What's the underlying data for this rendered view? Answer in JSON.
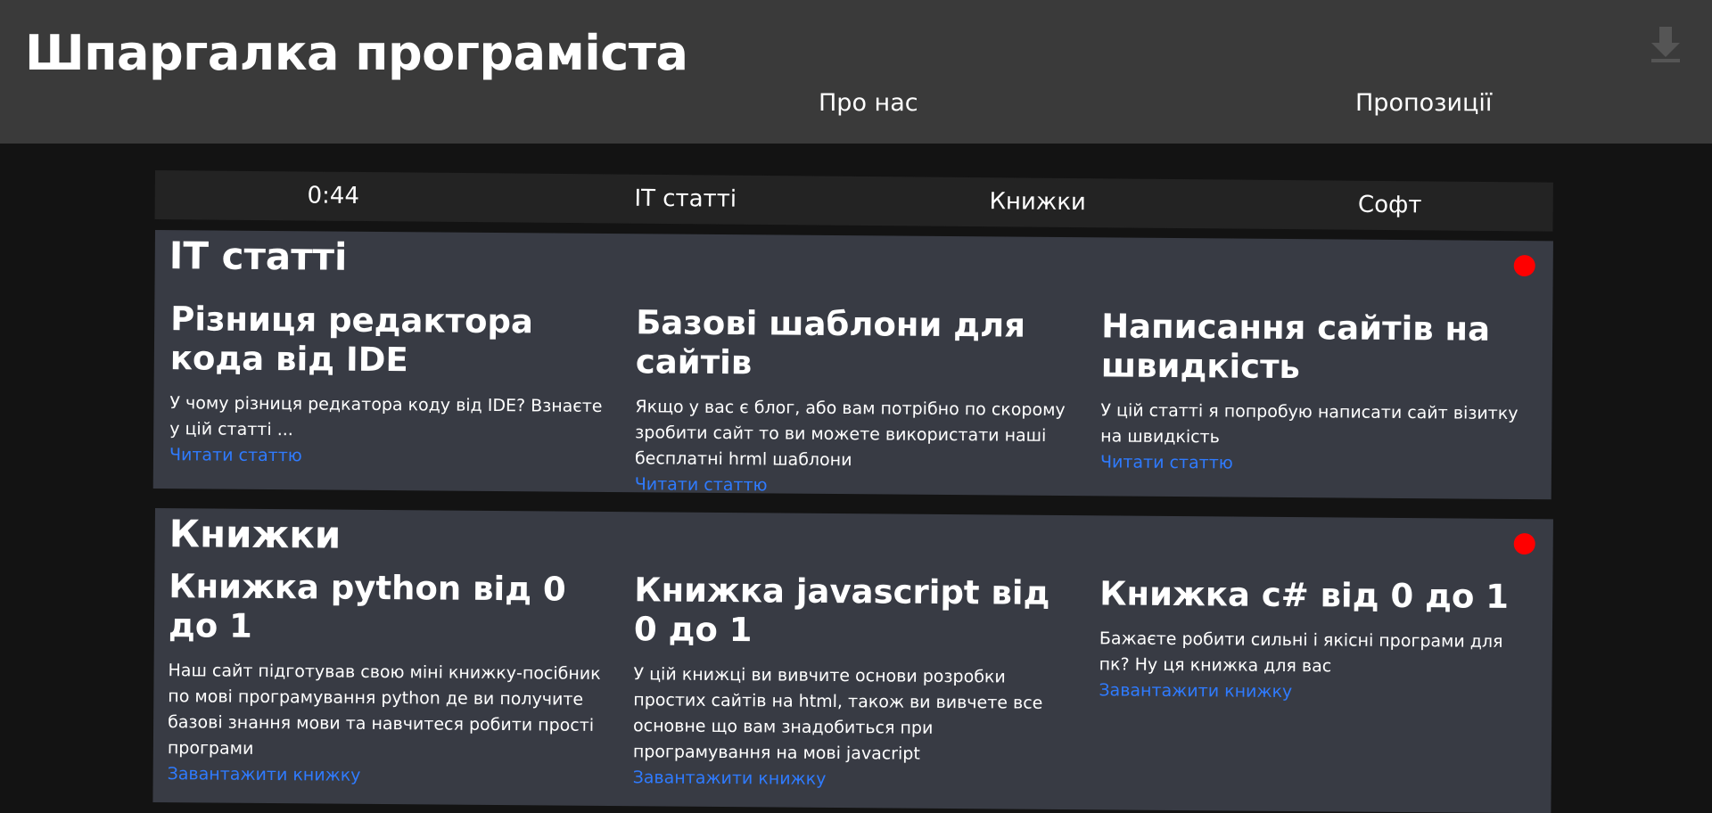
{
  "header": {
    "title": "Шпаргалка програміста",
    "links": [
      "Про нас",
      "Пропозиції"
    ],
    "download_icon": "download-arrow-icon"
  },
  "nav": {
    "items": [
      "0:44",
      "IT статті",
      "Книжки",
      "Софт"
    ]
  },
  "sections": [
    {
      "title": "IT статті",
      "cards": [
        {
          "title": "Різниця редактора кода від IDE",
          "text": "У чому різниця редкатора коду від IDE? Взнаєте у цій статті ...",
          "link": "Читати статтю"
        },
        {
          "title": "Базові шаблони для сайтів",
          "text": "Якщо у вас є блог, або вам потрібно по скорому зробити сайт то ви можете використати наші бесплатні hrml шаблони",
          "link": "Читати статтю"
        },
        {
          "title": "Написання сайтів на швидкість",
          "text": "У цій статті я попробую написати сайт візитку на швидкість",
          "link": "Читати статтю"
        }
      ]
    },
    {
      "title": "Книжки",
      "cards": [
        {
          "title": "Книжка python від 0 до 1",
          "text": "Наш сайт підготував свою міні книжку-посібник по мові програмування python де ви получите базові знання мови та навчитеся робити прості програми",
          "link": "Завантажити книжку"
        },
        {
          "title": "Книжка javascript від 0 до 1",
          "text": "У цій книжці ви вивчите основи розробки простих сайтів на html, також ви вивчете все основне що вам знадобиться при програмування на мові javacript",
          "link": "Завантажити книжку"
        },
        {
          "title": "Книжка c# від 0 до 1",
          "text": "Бажаєте робити сильні і якісні програми для пк? Ну ця книжка для вас",
          "link": "Завантажити книжку"
        }
      ]
    }
  ],
  "colors": {
    "header_bg": "#3a3a3a",
    "page_bg": "#131313",
    "section_bg": "#383b44",
    "link": "#2f7bff",
    "dot": "#ff0000"
  }
}
